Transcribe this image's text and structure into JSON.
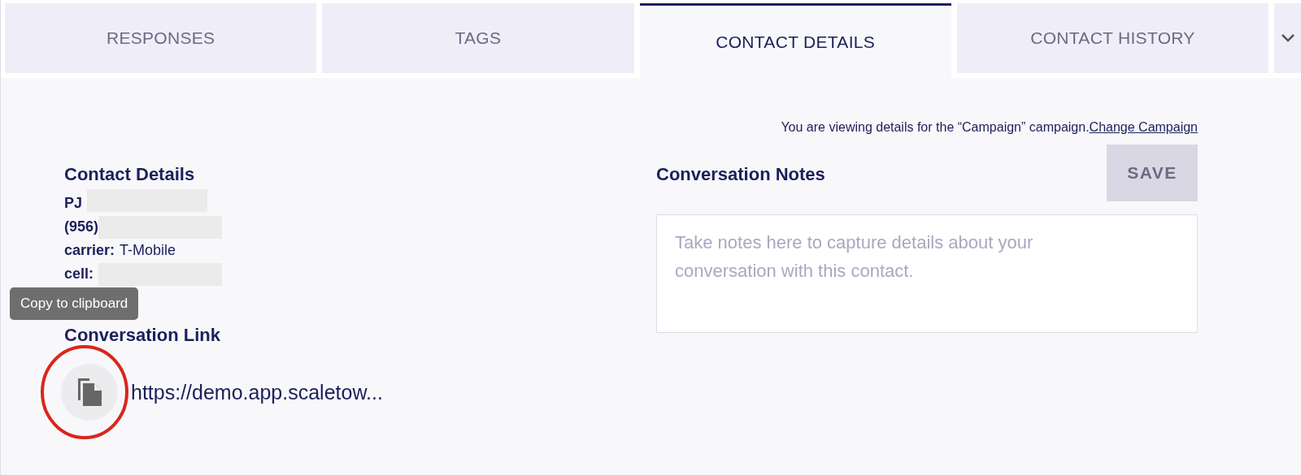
{
  "tabs": [
    {
      "label": "RESPONSES",
      "selected": false
    },
    {
      "label": "TAGS",
      "selected": false
    },
    {
      "label": "CONTACT DETAILS",
      "selected": true
    },
    {
      "label": "CONTACT HISTORY",
      "selected": false
    }
  ],
  "campaign_notice": {
    "text": "You are viewing details for the “Campaign” campaign.",
    "link": "Change Campaign"
  },
  "contact_details": {
    "heading": "Contact Details",
    "name": "PJ",
    "phone": "(956)",
    "carrier_label": "carrier:",
    "carrier": "T-Mobile",
    "cell_label": "cell:"
  },
  "conversation_link": {
    "heading": "Conversation Link",
    "url": "https://demo.app.scaletow...",
    "tooltip": "Copy to clipboard"
  },
  "conversation_notes": {
    "heading": "Conversation Notes",
    "save_button": "SAVE",
    "placeholder": "Take notes here to capture details about your conversation with this contact."
  }
}
